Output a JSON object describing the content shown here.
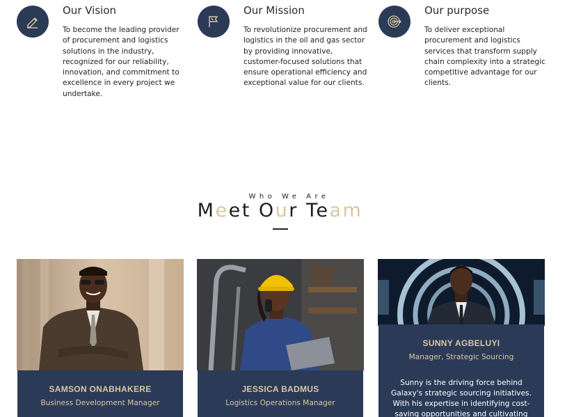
{
  "features": [
    {
      "icon": "pencil-icon",
      "title": "Our Vision",
      "text": "To become the leading provider of procurement and logistics solutions in the industry, recognized for our reliability, innovation, and commitment to excellence in every project we undertake."
    },
    {
      "icon": "flag-icon",
      "title": "Our Mission",
      "text": "To revolutionize procurement and logistics in the oil and gas sector by providing innovative, customer-focused solutions that ensure operational efficiency and exceptional value for our clients."
    },
    {
      "icon": "target-icon",
      "title": "Our purpose",
      "text": "To deliver exceptional procurement and logistics services that transform supply chain complexity into a strategic competitive advantage for our clients."
    }
  ],
  "team_section": {
    "eyebrow": "Who We Are",
    "title_parts": [
      {
        "text": "M",
        "light": false
      },
      {
        "text": "e",
        "light": true
      },
      {
        "text": "et ",
        "light": false
      },
      {
        "text": "O",
        "light": false
      },
      {
        "text": "u",
        "light": true
      },
      {
        "text": "r ",
        "light": false
      },
      {
        "text": "T",
        "light": false
      },
      {
        "text": "e",
        "light": false
      },
      {
        "text": "am",
        "light": true
      }
    ]
  },
  "team": [
    {
      "name": "SAMSON ONABHAKERE",
      "role": "Business Development Manager"
    },
    {
      "name": "JESSICA BADMUS",
      "role": "Logistics Operations Manager"
    },
    {
      "name": "SUNNY AGBELUYI",
      "role": "Manager, Strategic Sourcing",
      "bio": "Sunny is the driving force behind Galaxy's strategic sourcing initiatives. With his expertise in identifying cost-saving opportunities and cultivating long-term"
    }
  ],
  "colors": {
    "navy": "#2b3a57",
    "gold": "#d9c89e",
    "text": "#222222"
  }
}
